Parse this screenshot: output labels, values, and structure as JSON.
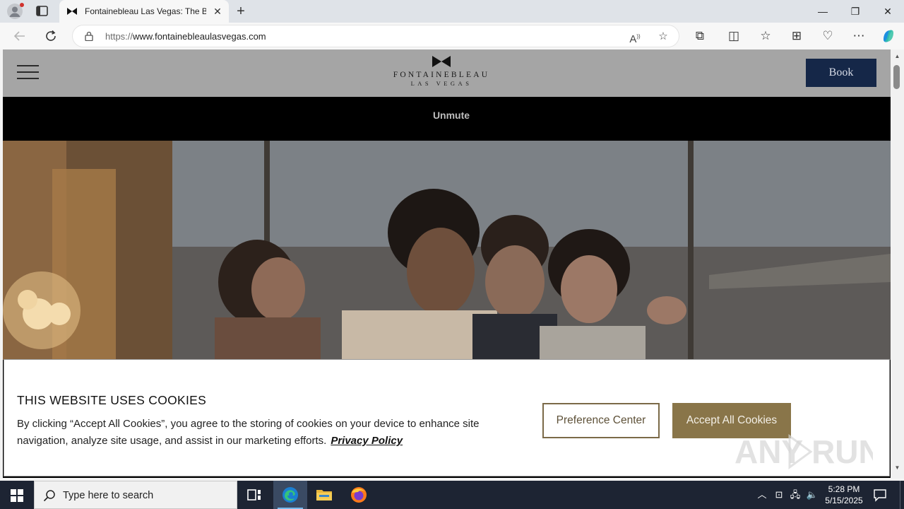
{
  "browser": {
    "tab": {
      "title": "Fontainebleau Las Vegas: The Best",
      "close_glyph": "✕"
    },
    "new_tab_glyph": "+",
    "window_controls": {
      "minimize": "—",
      "restore": "❐",
      "close": "✕"
    },
    "address": {
      "url_prefix": "https://",
      "url_host": "www.fontainebleaulasvegas.com"
    }
  },
  "site": {
    "logo": {
      "name": "FONTAINEBLEAU",
      "sub": "LAS VEGAS"
    },
    "book_label": "Book",
    "unmute_label": "Unmute"
  },
  "cookie_banner": {
    "title": "THIS WEBSITE USES COOKIES",
    "body": "By clicking “Accept All Cookies”, you agree to the storing of cookies on your device to enhance site navigation, analyze site usage, and assist in our marketing efforts.",
    "privacy_link": "Privacy Policy",
    "preference_label": "Preference Center",
    "accept_label": "Accept All Cookies",
    "watermark": "ANY RUN"
  },
  "taskbar": {
    "search_placeholder": "Type here to search",
    "time": "5:28 PM",
    "date": "5/15/2025"
  },
  "colors": {
    "book_button": "#152748",
    "accept_button": "#897549",
    "preference_border": "#7b6a48",
    "header_bg": "#a5a5a5",
    "taskbar_bg": "#1d2433"
  }
}
